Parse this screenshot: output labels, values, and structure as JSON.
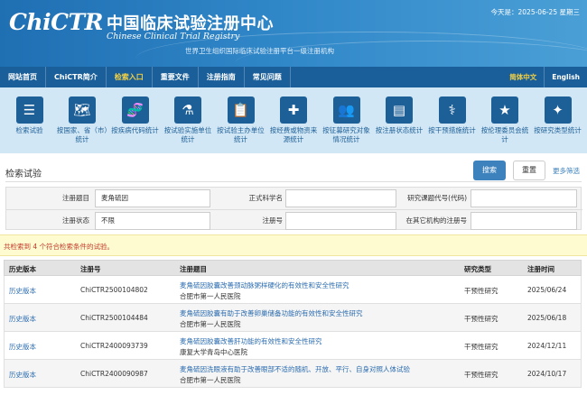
{
  "header": {
    "logo": "ChiCTR",
    "cn_title": "中国临床试验注册中心",
    "en_title": "Chinese Clinical Trial Registry",
    "sub_title": "世界卫生组织国际临床试验注册平台一级注册机构",
    "today": "今天是：2025-06-25 星期三"
  },
  "nav": {
    "items": [
      "网站首页",
      "ChiCTR简介",
      "检索入口",
      "重要文件",
      "注册指南",
      "常见问题"
    ],
    "active_index": 2,
    "lang_cn": "简体中文",
    "lang_en": "English"
  },
  "icons": [
    {
      "icon": "list-icon",
      "glyph": "☰",
      "label": "检索试验"
    },
    {
      "icon": "world-map-icon",
      "glyph": "🗺",
      "label": "按国家、省（市）统计"
    },
    {
      "icon": "dna-icon",
      "glyph": "🧬",
      "label": "按疾病代码统计"
    },
    {
      "icon": "flask-icon",
      "glyph": "⚗",
      "label": "按试验实施单位统计"
    },
    {
      "icon": "clipboard-icon",
      "glyph": "📋",
      "label": "按试验主办单位统计"
    },
    {
      "icon": "medical-kit-icon",
      "glyph": "✚",
      "label": "按经费或物资来源统计"
    },
    {
      "icon": "group-icon",
      "glyph": "👥",
      "label": "按征募研究对象情况统计"
    },
    {
      "icon": "progress-icon",
      "glyph": "▤",
      "label": "按注册状态统计"
    },
    {
      "icon": "doctor-icon",
      "glyph": "⚕",
      "label": "按干预措施统计"
    },
    {
      "icon": "star-icon",
      "glyph": "★",
      "label": "按伦理委员会统计"
    },
    {
      "icon": "sparkle-icon",
      "glyph": "✦",
      "label": "按研究类型统计"
    }
  ],
  "search": {
    "title": "检索试验",
    "search_button": "搜索",
    "reset_button": "重置",
    "more_filter": "更多筛选",
    "fields": {
      "reg_title_label": "注册题目",
      "reg_title_value": "麦角硫因",
      "sci_name_label": "正式科学名",
      "sci_name_value": "",
      "study_code_label": "研究课题代号(代码)",
      "study_code_value": "",
      "reg_status_label": "注册状态",
      "reg_status_value": "不限",
      "reg_no_label": "注册号",
      "reg_no_value": "",
      "other_reg_label": "在其它机构的注册号",
      "other_reg_value": ""
    }
  },
  "result": {
    "summary": "共检索到 4 个符合检索条件的试验。"
  },
  "table": {
    "headers": [
      "历史版本",
      "注册号",
      "注册题目",
      "研究类型",
      "注册时间"
    ],
    "rows": [
      {
        "history": "历史版本",
        "reg_no": "ChiCTR2500104802",
        "title": "麦角硫因胶囊改善颈动脉粥样硬化的有效性和安全性研究",
        "institution": "合肥市第一人民医院",
        "type": "干预性研究",
        "date": "2025/06/24"
      },
      {
        "history": "历史版本",
        "reg_no": "ChiCTR2500104484",
        "title": "麦角硫因胶囊有助于改善卵巢储备功能的有效性和安全性研究",
        "institution": "合肥市第一人民医院",
        "type": "干预性研究",
        "date": "2025/06/18"
      },
      {
        "history": "历史版本",
        "reg_no": "ChiCTR2400093739",
        "title": "麦角硫因胶囊改善肝功能的有效性和安全性研究",
        "institution": "康复大学青岛中心医院",
        "type": "干预性研究",
        "date": "2024/12/11"
      },
      {
        "history": "历史版本",
        "reg_no": "ChiCTR2400090987",
        "title": "麦角硫因洗眼液有助于改善眼部不适的随机、开放、平行、自身对照人体试验",
        "institution": "合肥市第一人民医院",
        "type": "干预性研究",
        "date": "2024/10/17"
      }
    ]
  }
}
